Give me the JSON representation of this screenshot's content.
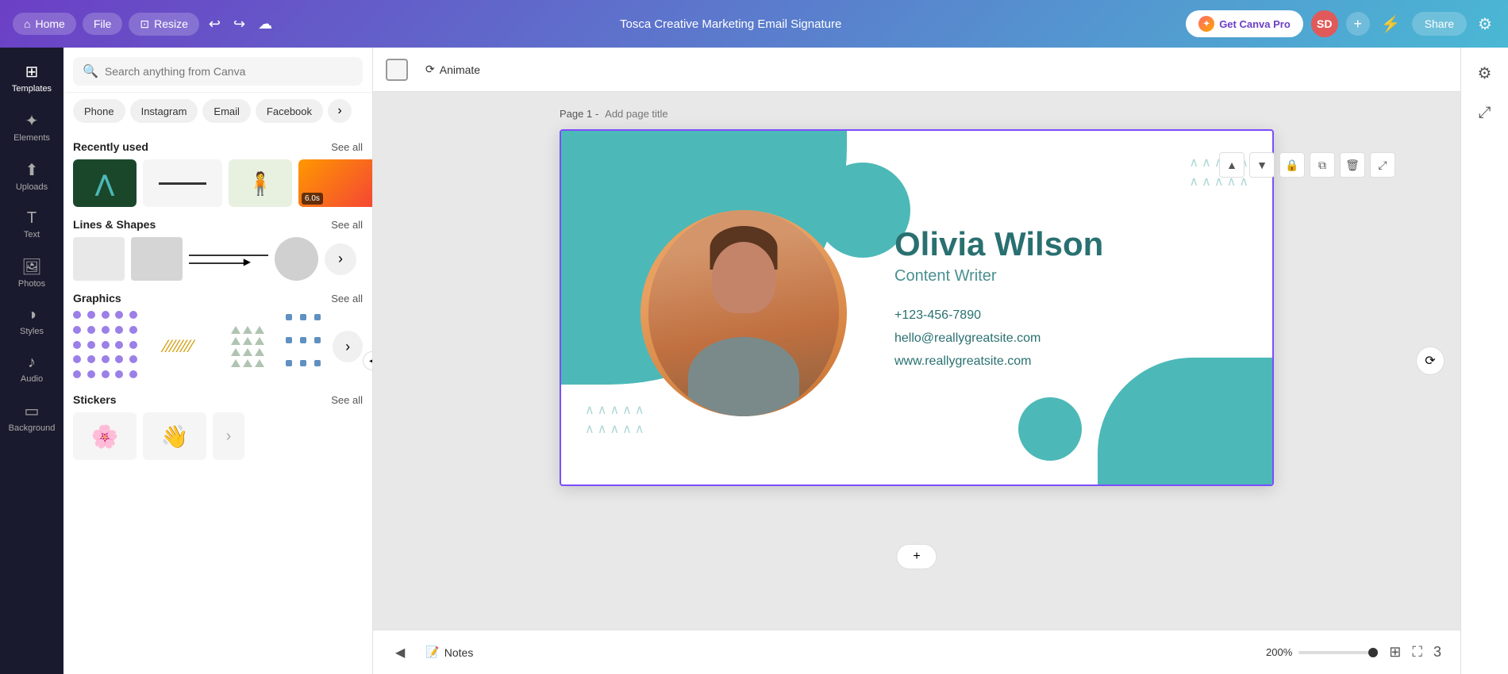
{
  "header": {
    "home_label": "Home",
    "file_label": "File",
    "resize_label": "Resize",
    "doc_title": "Tosca Creative Marketing Email Signature",
    "get_canva_pro_label": "Get Canva Pro",
    "avatar_initials": "SD",
    "share_label": "Share"
  },
  "left_nav": {
    "items": [
      {
        "id": "templates",
        "label": "Templates",
        "icon": "⊞"
      },
      {
        "id": "elements",
        "label": "Elements",
        "icon": "✦"
      },
      {
        "id": "uploads",
        "label": "Uploads",
        "icon": "⬆"
      },
      {
        "id": "text",
        "label": "Text",
        "icon": "T"
      },
      {
        "id": "photos",
        "label": "Photos",
        "icon": "🖼"
      },
      {
        "id": "styles",
        "label": "Styles",
        "icon": "◑"
      },
      {
        "id": "audio",
        "label": "Audio",
        "icon": "♪"
      },
      {
        "id": "background",
        "label": "Background",
        "icon": "▭"
      }
    ]
  },
  "search": {
    "placeholder": "Search anything from Canva"
  },
  "filter_tabs": [
    {
      "label": "Phone"
    },
    {
      "label": "Instagram"
    },
    {
      "label": "Email"
    },
    {
      "label": "Facebook"
    }
  ],
  "recently_used": {
    "title": "Recently used",
    "see_all": "See all"
  },
  "lines_shapes": {
    "title": "Lines & Shapes",
    "see_all": "See all"
  },
  "graphics": {
    "title": "Graphics",
    "see_all": "See all"
  },
  "stickers": {
    "title": "Stickers",
    "see_all": "See all"
  },
  "toolbar": {
    "animate_label": "Animate"
  },
  "page": {
    "label": "Page 1 -",
    "title_placeholder": "Add page title"
  },
  "design": {
    "name": "Olivia Wilson",
    "role": "Content Writer",
    "phone": "+123-456-7890",
    "email": "hello@reallygreatsite.com",
    "website": "www.reallygreatsite.com"
  },
  "bottom": {
    "notes_label": "Notes",
    "zoom_label": "200%",
    "page_num": "3"
  }
}
